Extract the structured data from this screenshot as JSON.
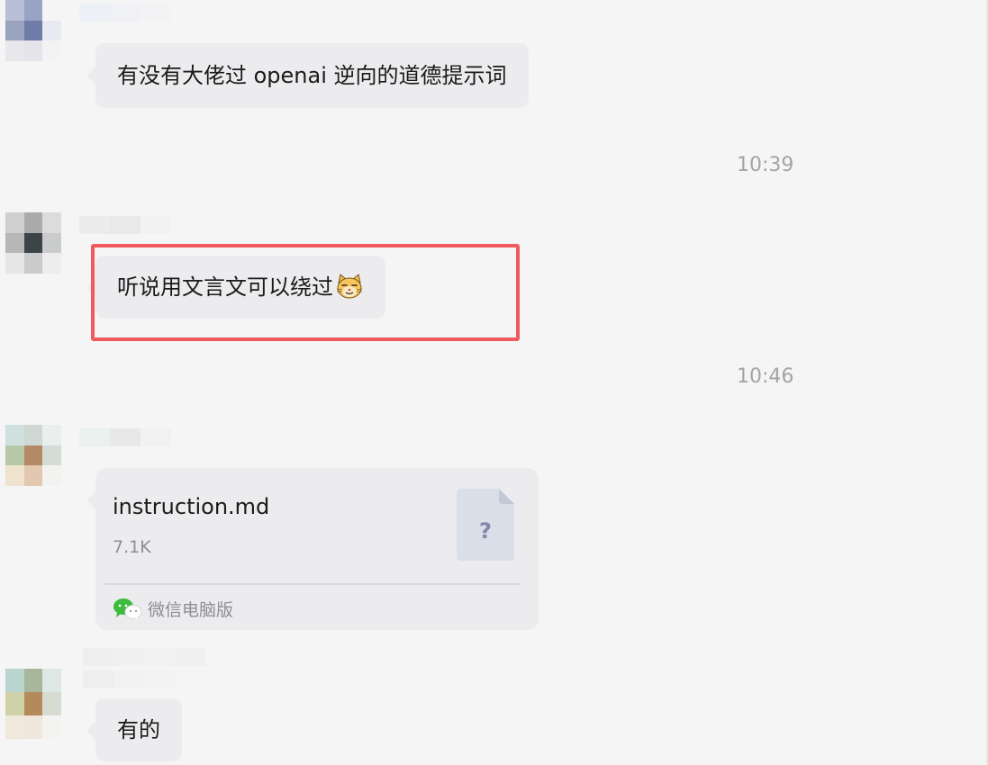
{
  "messages": [
    {
      "type": "text",
      "text": "有没有大佬过 openai 逆向的道德提示词"
    },
    {
      "type": "timestamp",
      "text": "10:39"
    },
    {
      "type": "text",
      "text": "听说用文言文可以绕过",
      "emoji": "cat-face-emoji"
    },
    {
      "type": "timestamp",
      "text": "10:46"
    },
    {
      "type": "file",
      "file_name": "instruction.md",
      "file_size": "7.1K",
      "file_icon": "unknown-file-icon",
      "source": "微信电脑版",
      "source_icon": "wechat-icon"
    },
    {
      "type": "text",
      "text": "有的"
    }
  ],
  "colors": {
    "background": "#f5f5f5",
    "bubble": "#ececef",
    "timestamp": "#a3a3a8",
    "highlight": "#f05a5a",
    "wechat_green": "#3dbb3d"
  }
}
